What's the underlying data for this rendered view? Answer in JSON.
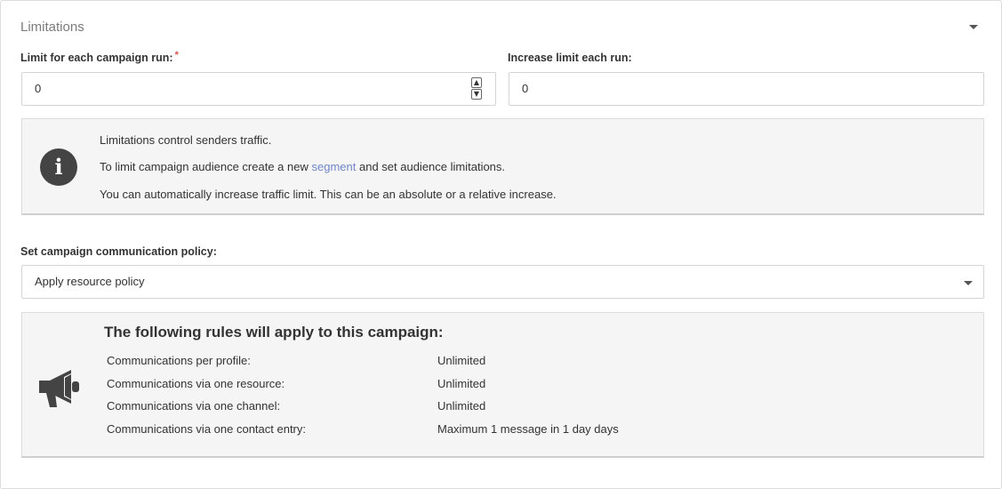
{
  "section": {
    "title": "Limitations"
  },
  "limit_field": {
    "label": "Limit for each campaign run:",
    "required_mark": "*",
    "value": "0"
  },
  "increase_field": {
    "label": "Increase limit each run:",
    "value": "0"
  },
  "info": {
    "line1": "Limitations control senders traffic.",
    "line2_before": "To limit campaign audience create a new",
    "line2_link": "segment",
    "line2_after": "and set audience limitations.",
    "line3": "You can automatically increase traffic limit. This can be an absolute or a relative increase."
  },
  "policy": {
    "label": "Set campaign communication policy:",
    "selected": "Apply resource policy"
  },
  "rules": {
    "heading": "The following rules will apply to this campaign:",
    "items": [
      {
        "label": "Communications per profile:",
        "value": "Unlimited"
      },
      {
        "label": "Communications via one resource:",
        "value": "Unlimited"
      },
      {
        "label": "Communications via one channel:",
        "value": "Unlimited"
      },
      {
        "label": "Communications via one contact entry:",
        "value": "Maximum 1 message in 1 day days"
      }
    ]
  },
  "icons": {
    "collapse": "chevron-down-icon",
    "info": "info-circle-icon",
    "megaphone": "megaphone-icon"
  },
  "colors": {
    "link": "#6f86c9",
    "required": "#d9534f",
    "icon": "#444444",
    "box_background": "#f5f5f5"
  }
}
